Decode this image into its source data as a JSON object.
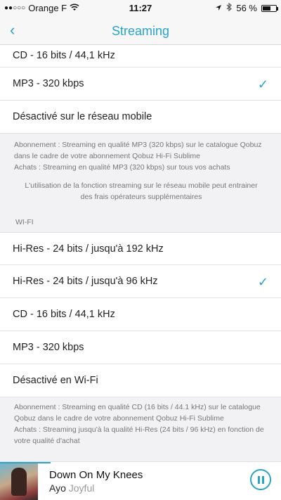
{
  "status_bar": {
    "signal": "●●○○○",
    "carrier": "Orange F",
    "time": "11:27",
    "battery": "56 %",
    "battery_level": 0.56,
    "icons": [
      "wifi-icon",
      "location-arrow-icon",
      "bluetooth-icon",
      "battery-icon"
    ]
  },
  "nav": {
    "back_glyph": "‹",
    "title": "Streaming"
  },
  "mobile_network": {
    "options": [
      {
        "label": "CD - 16 bits / 44,1 kHz",
        "selected": false
      },
      {
        "label": "MP3 - 320 kbps",
        "selected": true
      },
      {
        "label": "Désactivé sur le réseau mobile",
        "selected": false
      }
    ],
    "info": {
      "subscription": "Abonnement : Streaming en qualité MP3 (320 kbps) sur le catalogue Qobuz dans le cadre de votre abonnement Qobuz Hi-Fi Sublime",
      "purchases": "Achats : Streaming en qualité MP3 (320 kbps) sur tous vos achats",
      "warning": "L'utilisation de la fonction streaming sur le réseau mobile peut entrainer des frais opérateurs supplémentaires"
    }
  },
  "wifi": {
    "header": "WI-FI",
    "options": [
      {
        "label": "Hi-Res - 24 bits / jusqu'à 192 kHz",
        "selected": false
      },
      {
        "label": "Hi-Res - 24 bits / jusqu'à 96 kHz",
        "selected": true
      },
      {
        "label": "CD - 16 bits / 44,1 kHz",
        "selected": false
      },
      {
        "label": "MP3 - 320 kbps",
        "selected": false
      },
      {
        "label": "Désactivé en Wi-Fi",
        "selected": false
      }
    ],
    "info": {
      "subscription": "Abonnement : Streaming en qualité CD (16 bits / 44.1 kHz) sur le catalogue Qobuz dans le cadre de votre abonnement Qobuz Hi-Fi Sublime",
      "purchases": "Achats : Streaming jusqu'à la qualité Hi-Res (24 bits / 96 kHz) en fonction de votre qualité d'achat"
    }
  },
  "check_glyph": "✓",
  "player": {
    "title": "Down On My Knees",
    "artist": "Ayo",
    "album": "Joyful",
    "progress": 0.18
  },
  "colors": {
    "accent": "#2aa3c7",
    "background": "#f2f2f4"
  }
}
